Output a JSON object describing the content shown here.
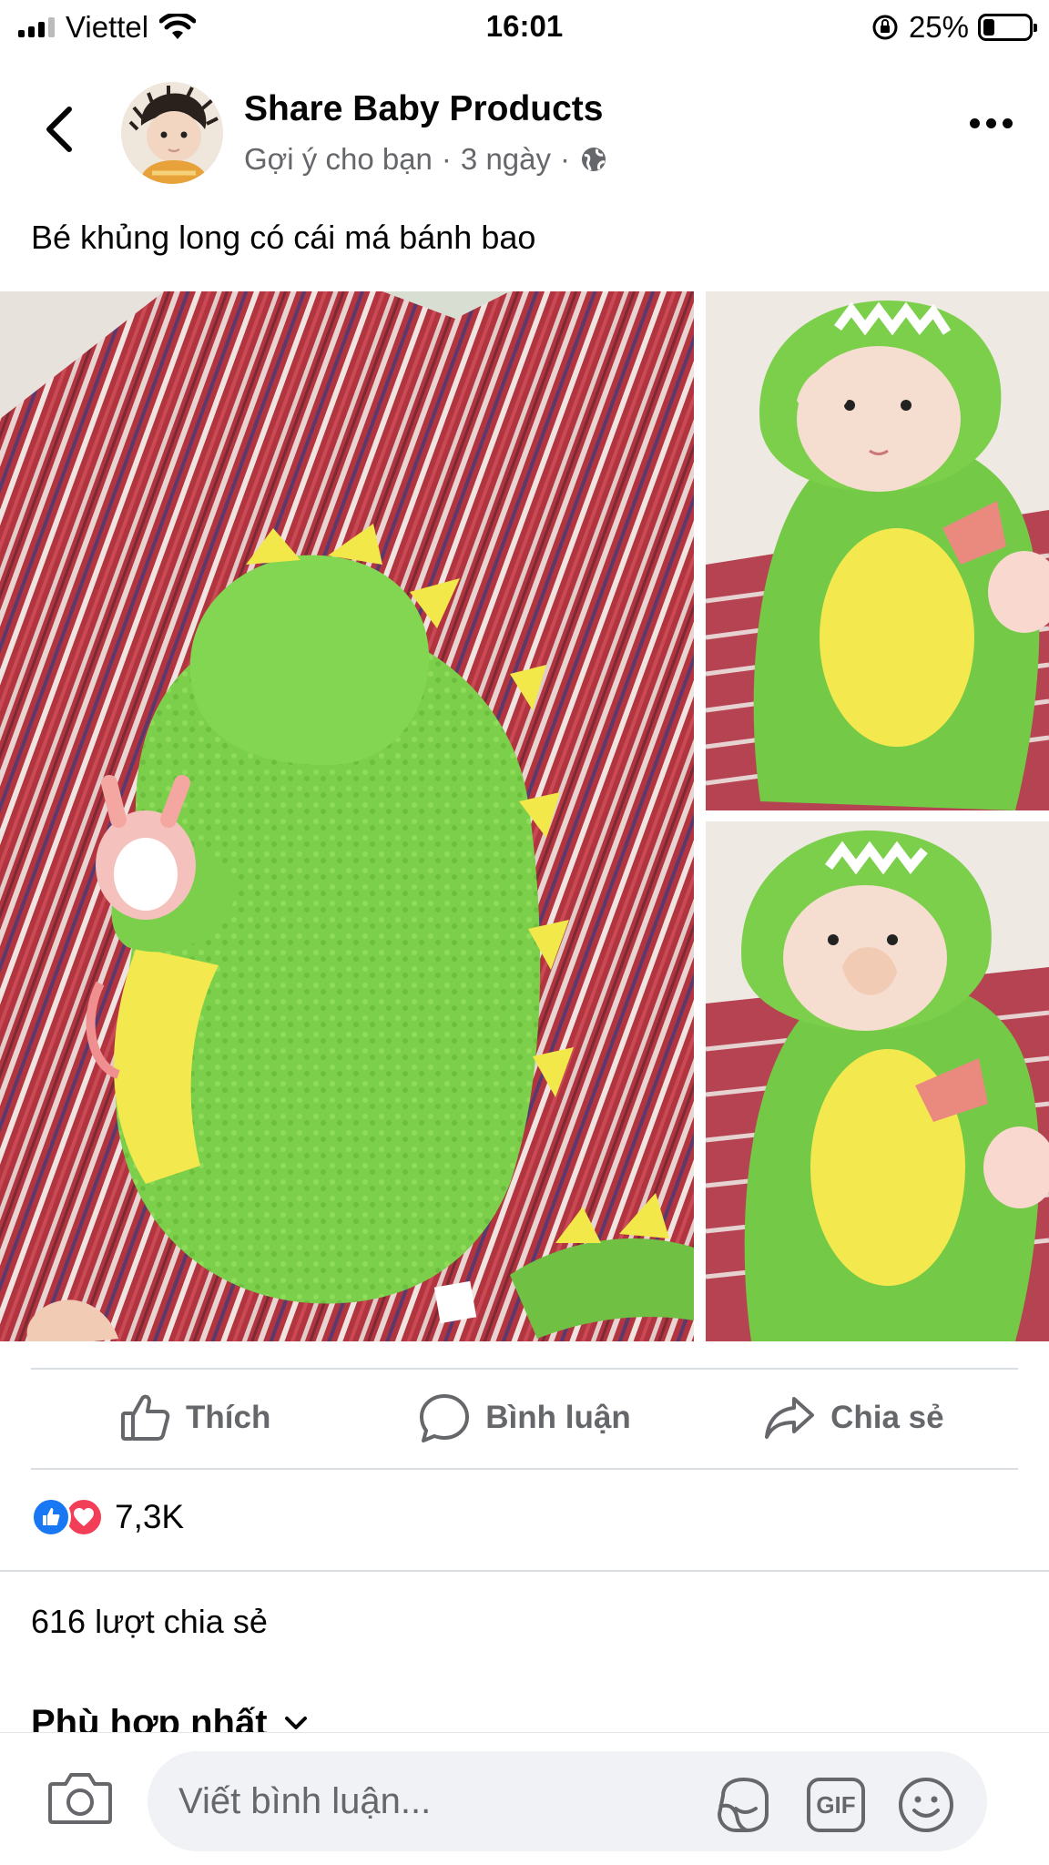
{
  "status_bar": {
    "carrier": "Viettel",
    "time": "16:01",
    "battery_percent": "25%",
    "battery_level": 0.25
  },
  "post": {
    "page_name": "Share Baby Products",
    "meta_label": "Gợi ý cho bạn",
    "meta_separator": "·",
    "time_ago": "3 ngày",
    "caption": "Bé khủng long có cái má bánh bao",
    "photo_count": 3
  },
  "actions": {
    "like": "Thích",
    "comment": "Bình luận",
    "share": "Chia sẻ"
  },
  "stats": {
    "reaction_count": "7,3K",
    "reaction_types": [
      "like",
      "love"
    ],
    "share_count": "616 lượt chia sẻ"
  },
  "comments": {
    "sort_label": "Phù hợp nhất",
    "input_placeholder": "Viết bình luận..."
  },
  "icons": {
    "back": "back-chevron-icon",
    "more": "more-dots-icon",
    "globe": "globe-icon",
    "like": "thumbs-up-icon",
    "comment": "speech-bubble-icon",
    "share": "share-arrow-icon",
    "camera": "camera-icon",
    "sticker": "sticker-icon",
    "gif": "gif-icon",
    "emoji": "emoji-icon"
  },
  "colors": {
    "text_primary": "#050505",
    "text_secondary": "#65676b",
    "like_blue": "#1877f2",
    "love_red": "#f33e58",
    "input_bg": "#f0f2f5",
    "divider": "#dadde1"
  }
}
